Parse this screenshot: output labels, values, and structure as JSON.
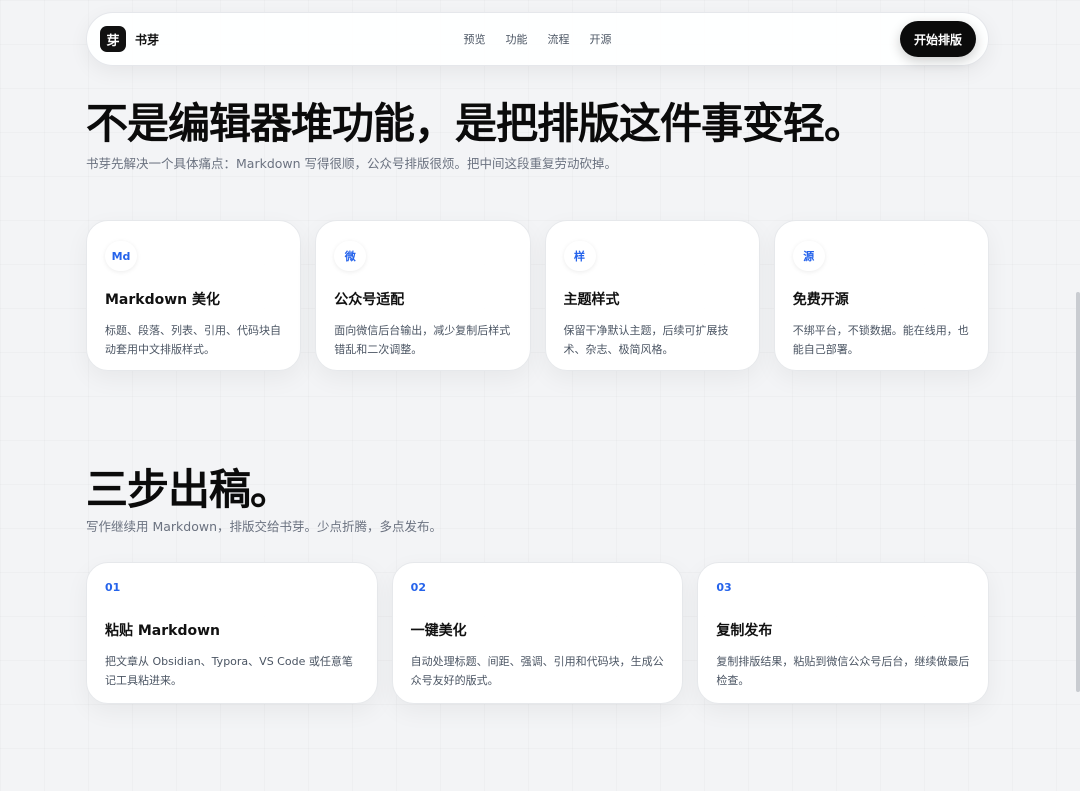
{
  "nav": {
    "logo": "芽",
    "brand": "书芽",
    "links": [
      "预览",
      "功能",
      "流程",
      "开源"
    ],
    "cta": "开始排版"
  },
  "hero": {
    "title": "不是编辑器堆功能，是把排版这件事变轻。",
    "subtitle": "书芽先解决一个具体痛点：Markdown 写得很顺，公众号排版很烦。把中间这段重复劳动砍掉。"
  },
  "features": [
    {
      "badge": "Md",
      "title": "Markdown 美化",
      "desc": "标题、段落、列表、引用、代码块自动套用中文排版样式。"
    },
    {
      "badge": "微",
      "title": "公众号适配",
      "desc": "面向微信后台输出，减少复制后样式错乱和二次调整。"
    },
    {
      "badge": "样",
      "title": "主题样式",
      "desc": "保留干净默认主题，后续可扩展技术、杂志、极简风格。"
    },
    {
      "badge": "源",
      "title": "免费开源",
      "desc": "不绑平台，不锁数据。能在线用，也能自己部署。"
    }
  ],
  "workflow": {
    "title": "三步出稿。",
    "subtitle": "写作继续用 Markdown，排版交给书芽。少点折腾，多点发布。",
    "steps": [
      {
        "num": "01",
        "title": "粘贴 Markdown",
        "desc": "把文章从 Obsidian、Typora、VS Code 或任意笔记工具粘进来。"
      },
      {
        "num": "02",
        "title": "一键美化",
        "desc": "自动处理标题、间距、强调、引用和代码块，生成公众号友好的版式。"
      },
      {
        "num": "03",
        "title": "复制发布",
        "desc": "复制排版结果，粘贴到微信公众号后台，继续做最后检查。"
      }
    ]
  },
  "colors": {
    "accent": "#2563eb",
    "cta_bg": "#0b0b0b",
    "page_bg": "#f3f4f6"
  }
}
